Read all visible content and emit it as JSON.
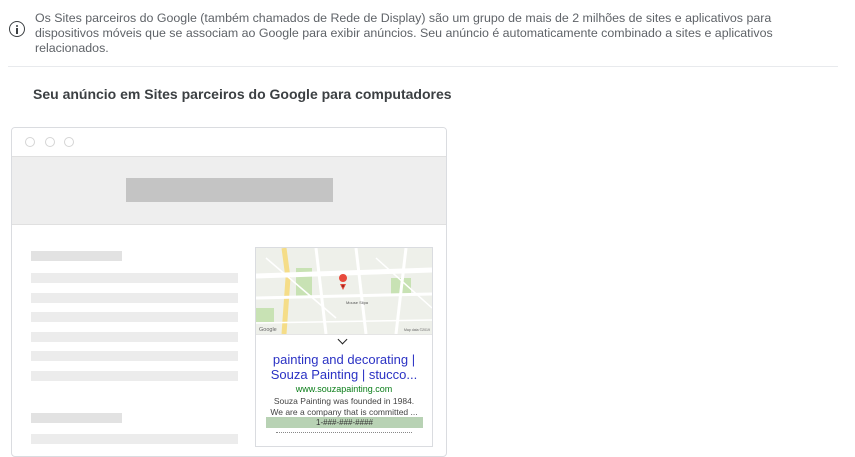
{
  "info": {
    "icon": "info-icon",
    "text": "Os Sites parceiros do Google (também chamados de Rede de Display) são um grupo de mais de 2 milhões de sites e aplicativos para dispositivos móveis que se associam ao Google para exibir anúncios. Seu anúncio é automaticamente combinado a sites e aplicativos relacionados."
  },
  "heading": "Seu anúncio em Sites parceiros do Google para computadores",
  "ad": {
    "title_line1": "painting and decorating |",
    "title_line2": "Souza Painting | stucco...",
    "url": "www.souzapainting.com",
    "desc_line1": "Souza Painting was founded in 1984.",
    "desc_line2": "We are a company that is committed ...",
    "phone": "1-###-###-####",
    "map": {
      "attribution": "Google",
      "map_data": "Map data ©2019",
      "place_label": "Mouse Siipa",
      "colors": {
        "road_major": "#ffffff",
        "road_highway": "#f5dd88",
        "park": "#c8e2b4",
        "pin": "#e84a3d"
      }
    }
  }
}
